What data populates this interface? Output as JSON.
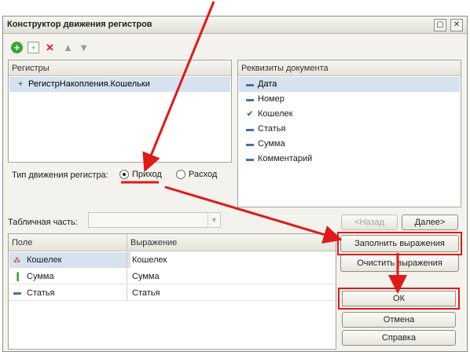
{
  "window": {
    "title": "Конструктор движения регистров",
    "more_icon": "more-icon",
    "close_icon": "close-icon"
  },
  "toolbar": {
    "icons": [
      "add-icon",
      "copy-icon",
      "delete-icon",
      "move-up-icon",
      "move-down-icon"
    ]
  },
  "registers": {
    "header": "Регистры",
    "items": [
      {
        "label": "РегистрНакопления.Кошельки",
        "icon": "accumulation-register-icon",
        "selected": true
      }
    ]
  },
  "requisites": {
    "header": "Реквизиты документа",
    "items": [
      {
        "label": "Дата",
        "icon": "attribute-icon",
        "selected": true
      },
      {
        "label": "Номер",
        "icon": "attribute-icon"
      },
      {
        "label": "Кошелек",
        "icon": "used-attribute-icon"
      },
      {
        "label": "Статья",
        "icon": "attribute-icon"
      },
      {
        "label": "Сумма",
        "icon": "attribute-icon"
      },
      {
        "label": "Комментарий",
        "icon": "attribute-icon"
      }
    ]
  },
  "movement": {
    "label": "Тип движения регистра:",
    "options": [
      {
        "label": "Приход",
        "selected": true
      },
      {
        "label": "Расход",
        "selected": false
      }
    ]
  },
  "tabular": {
    "label": "Табличная часть:",
    "value": ""
  },
  "nav": {
    "back_label": "<Назад",
    "next_label": "Далее>"
  },
  "mapping": {
    "columns": [
      "Поле",
      "Выражение"
    ],
    "rows": [
      {
        "field": "Кошелек",
        "expr": "Кошелек",
        "icon": "dimension-icon",
        "selected": true
      },
      {
        "field": "Сумма",
        "expr": "Сумма",
        "icon": "resource-icon"
      },
      {
        "field": "Статья",
        "expr": "Статья",
        "icon": "attribute-icon"
      }
    ]
  },
  "actions": {
    "fill_label": "Заполнить выражения",
    "clear_label": "Очистить выражения",
    "ok_label": "ОК",
    "cancel_label": "Отмена",
    "help_label": "Справка"
  },
  "colors": {
    "annotation": "#e01919",
    "selection": "#d7e2f0"
  }
}
